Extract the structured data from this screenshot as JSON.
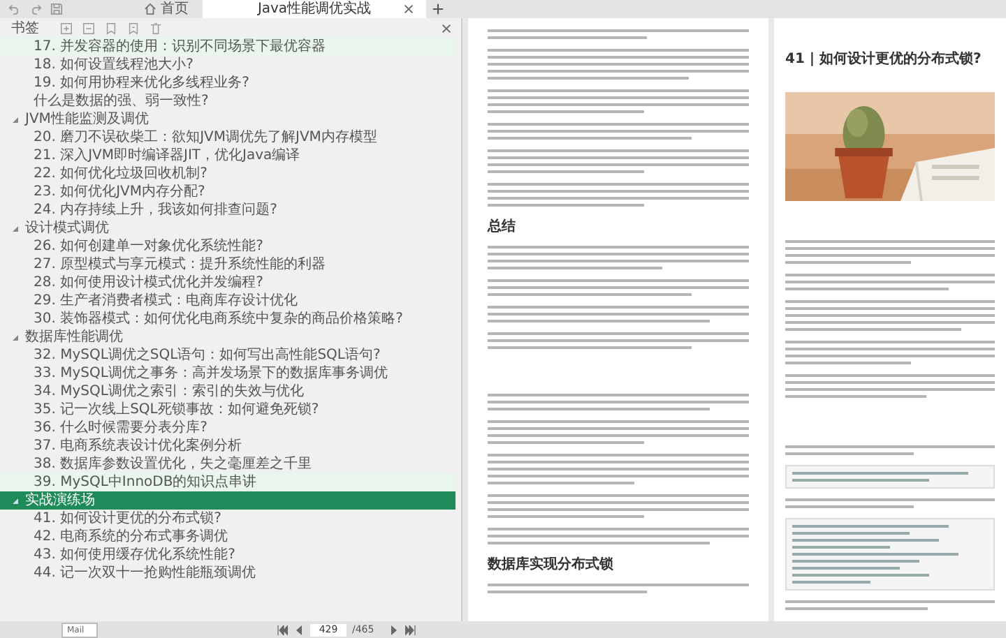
{
  "tabs": [
    {
      "label": "首页",
      "selected": false,
      "kind": "home"
    },
    {
      "label": "Java性能调优实战",
      "selected": true,
      "kind": "document"
    }
  ],
  "sidebar": {
    "title": "书签",
    "toc": [
      {
        "children": [
          {
            "label": "17. 并发容器的使用：识别不同场景下最优容器",
            "selected": false,
            "highlighted": true
          },
          {
            "label": "18. 如何设置线程池大小?",
            "selected": false,
            "highlighted": false
          },
          {
            "label": "19. 如何用协程来优化多线程业务?",
            "selected": false,
            "highlighted": false
          },
          {
            "label": "什么是数据的强、弱一致性?",
            "selected": false,
            "highlighted": false
          }
        ]
      },
      {
        "title": "JVM性能监测及调优",
        "expanded": true,
        "selected": false,
        "children": [
          {
            "label": "20. 磨刀不误砍柴工：欲知JVM调优先了解JVM内存模型",
            "selected": false,
            "highlighted": false
          },
          {
            "label": "21. 深入JVM即时编译器JIT，优化Java编译",
            "selected": false,
            "highlighted": false
          },
          {
            "label": "22. 如何优化垃圾回收机制?",
            "selected": false,
            "highlighted": false
          },
          {
            "label": "23. 如何优化JVM内存分配?",
            "selected": false,
            "highlighted": false
          },
          {
            "label": "24. 内存持续上升，我该如何排查问题?",
            "selected": false,
            "highlighted": false
          }
        ]
      },
      {
        "title": "设计模式调优",
        "expanded": true,
        "selected": false,
        "children": [
          {
            "label": "26. 如何创建单一对象优化系统性能?",
            "selected": false,
            "highlighted": false
          },
          {
            "label": "27. 原型模式与享元模式：提升系统性能的利器",
            "selected": false,
            "highlighted": false
          },
          {
            "label": "28. 如何使用设计模式优化并发编程?",
            "selected": false,
            "highlighted": false
          },
          {
            "label": "29. 生产者消费者模式：电商库存设计优化",
            "selected": false,
            "highlighted": false
          },
          {
            "label": "30. 装饰器模式：如何优化电商系统中复杂的商品价格策略?",
            "selected": false,
            "highlighted": false
          }
        ]
      },
      {
        "title": "数据库性能调优",
        "expanded": true,
        "selected": false,
        "children": [
          {
            "label": "32. MySQL调优之SQL语句：如何写出高性能SQL语句?",
            "selected": false,
            "highlighted": false
          },
          {
            "label": "33. MySQL调优之事务：高并发场景下的数据库事务调优",
            "selected": false,
            "highlighted": false
          },
          {
            "label": "34. MySQL调优之索引：索引的失效与优化",
            "selected": false,
            "highlighted": false
          },
          {
            "label": "35. 记一次线上SQL死锁事故：如何避免死锁?",
            "selected": false,
            "highlighted": false
          },
          {
            "label": "36. 什么时候需要分表分库?",
            "selected": false,
            "highlighted": false
          },
          {
            "label": "37. 电商系统表设计优化案例分析",
            "selected": false,
            "highlighted": false
          },
          {
            "label": "38. 数据库参数设置优化，失之毫厘差之千里",
            "selected": false,
            "highlighted": false
          },
          {
            "label": "39. MySQL中InnoDB的知识点串讲",
            "selected": false,
            "highlighted": true
          }
        ]
      },
      {
        "title": "实战演练场",
        "expanded": true,
        "selected": true,
        "children": [
          {
            "label": "41. 如何设计更优的分布式锁?",
            "selected": false,
            "highlighted": false
          },
          {
            "label": "42. 电商系统的分布式事务调优",
            "selected": false,
            "highlighted": false
          },
          {
            "label": "43. 如何使用缓存优化系统性能?",
            "selected": false,
            "highlighted": false
          },
          {
            "label": "44. 记一次双十一抢购性能瓶颈调优",
            "selected": false,
            "highlighted": false
          }
        ]
      }
    ]
  },
  "document": {
    "left_page": {
      "headings": [
        "总结",
        "数据库实现分布式锁"
      ]
    },
    "right_page": {
      "title": "41 | 如何设计更优的分布式锁?"
    }
  },
  "pager": {
    "field": "Mail",
    "page": "429",
    "total": "/465"
  }
}
